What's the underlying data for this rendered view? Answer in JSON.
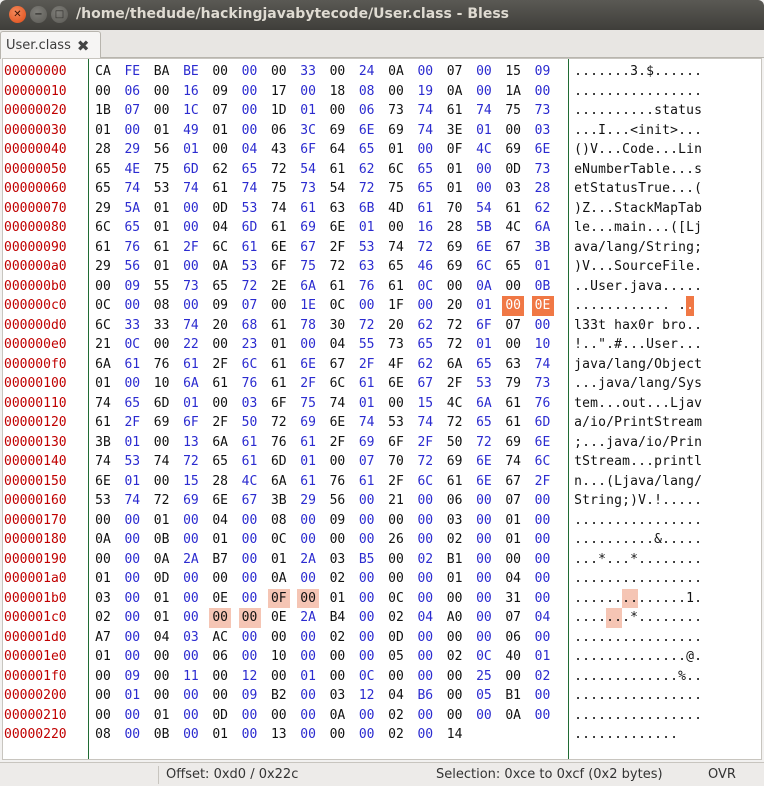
{
  "window": {
    "title": "/home/thedude/hackingjavabytecode/User.class - Bless",
    "close_glyph": "✕",
    "min_glyph": "−",
    "max_glyph": "□"
  },
  "tab": {
    "label": "User.class",
    "close_glyph": "✖"
  },
  "selection": {
    "rows": [
      12
    ],
    "cols": [
      14,
      15
    ],
    "highlight": [
      [
        27,
        6
      ],
      [
        27,
        7
      ],
      [
        28,
        4
      ],
      [
        28,
        5
      ]
    ]
  },
  "colors": {
    "selection": "#f07845",
    "highlight": "#f5c5b4",
    "offset_text": "#c00000",
    "odd_column_text": "#2b2bd0"
  },
  "hex": {
    "rows": [
      {
        "offset": "00000000",
        "bytes": "CA FE BA BE 00 00 00 33 00 24 0A 00 07 00 15 09",
        "ascii": ".......3.$......"
      },
      {
        "offset": "00000010",
        "bytes": "00 06 00 16 09 00 17 00 18 08 00 19 0A 00 1A 00",
        "ascii": "................"
      },
      {
        "offset": "00000020",
        "bytes": "1B 07 00 1C 07 00 1D 01 00 06 73 74 61 74 75 73",
        "ascii": "..........status"
      },
      {
        "offset": "00000030",
        "bytes": "01 00 01 49 01 00 06 3C 69 6E 69 74 3E 01 00 03",
        "ascii": "...I...<init>..."
      },
      {
        "offset": "00000040",
        "bytes": "28 29 56 01 00 04 43 6F 64 65 01 00 0F 4C 69 6E",
        "ascii": "()V...Code...Lin"
      },
      {
        "offset": "00000050",
        "bytes": "65 4E 75 6D 62 65 72 54 61 62 6C 65 01 00 0D 73",
        "ascii": "eNumberTable...s"
      },
      {
        "offset": "00000060",
        "bytes": "65 74 53 74 61 74 75 73 54 72 75 65 01 00 03 28",
        "ascii": "etStatusTrue...("
      },
      {
        "offset": "00000070",
        "bytes": "29 5A 01 00 0D 53 74 61 63 6B 4D 61 70 54 61 62",
        "ascii": ")Z...StackMapTab"
      },
      {
        "offset": "00000080",
        "bytes": "6C 65 01 00 04 6D 61 69 6E 01 00 16 28 5B 4C 6A",
        "ascii": "le...main...([Lj"
      },
      {
        "offset": "00000090",
        "bytes": "61 76 61 2F 6C 61 6E 67 2F 53 74 72 69 6E 67 3B",
        "ascii": "ava/lang/String;"
      },
      {
        "offset": "000000a0",
        "bytes": "29 56 01 00 0A 53 6F 75 72 63 65 46 69 6C 65 01",
        "ascii": ")V...SourceFile."
      },
      {
        "offset": "000000b0",
        "bytes": "00 09 55 73 65 72 2E 6A 61 76 61 0C 00 0A 00 0B",
        "ascii": "..User.java....."
      },
      {
        "offset": "000000c0",
        "bytes": "0C 00 08 00 09 07 00 1E 0C 00 1F 00 20 01 00 0E",
        "ascii": "............ .."
      },
      {
        "offset": "000000d0",
        "bytes": "6C 33 33 74 20 68 61 78 30 72 20 62 72 6F 07 00",
        "ascii": "l33t hax0r bro.."
      },
      {
        "offset": "000000e0",
        "bytes": "21 0C 00 22 00 23 01 00 04 55 73 65 72 01 00 10",
        "ascii": "!..\".#...User..."
      },
      {
        "offset": "000000f0",
        "bytes": "6A 61 76 61 2F 6C 61 6E 67 2F 4F 62 6A 65 63 74",
        "ascii": "java/lang/Object"
      },
      {
        "offset": "00000100",
        "bytes": "01 00 10 6A 61 76 61 2F 6C 61 6E 67 2F 53 79 73",
        "ascii": "...java/lang/Sys"
      },
      {
        "offset": "00000110",
        "bytes": "74 65 6D 01 00 03 6F 75 74 01 00 15 4C 6A 61 76",
        "ascii": "tem...out...Ljav"
      },
      {
        "offset": "00000120",
        "bytes": "61 2F 69 6F 2F 50 72 69 6E 74 53 74 72 65 61 6D",
        "ascii": "a/io/PrintStream"
      },
      {
        "offset": "00000130",
        "bytes": "3B 01 00 13 6A 61 76 61 2F 69 6F 2F 50 72 69 6E",
        "ascii": ";...java/io/Prin"
      },
      {
        "offset": "00000140",
        "bytes": "74 53 74 72 65 61 6D 01 00 07 70 72 69 6E 74 6C",
        "ascii": "tStream...printl"
      },
      {
        "offset": "00000150",
        "bytes": "6E 01 00 15 28 4C 6A 61 76 61 2F 6C 61 6E 67 2F",
        "ascii": "n...(Ljava/lang/"
      },
      {
        "offset": "00000160",
        "bytes": "53 74 72 69 6E 67 3B 29 56 00 21 00 06 00 07 00",
        "ascii": "String;)V.!....."
      },
      {
        "offset": "00000170",
        "bytes": "00 00 01 00 04 00 08 00 09 00 00 00 03 00 01 00",
        "ascii": "................"
      },
      {
        "offset": "00000180",
        "bytes": "0A 00 0B 00 01 00 0C 00 00 00 26 00 02 00 01 00",
        "ascii": "..........&....."
      },
      {
        "offset": "00000190",
        "bytes": "00 00 0A 2A B7 00 01 2A 03 B5 00 02 B1 00 00 00",
        "ascii": "...*...*........"
      },
      {
        "offset": "000001a0",
        "bytes": "01 00 0D 00 00 00 0A 00 02 00 00 00 01 00 04 00",
        "ascii": "................"
      },
      {
        "offset": "000001b0",
        "bytes": "03 00 01 00 0E 00 0F 00 01 00 0C 00 00 00 31 00",
        "ascii": "..............1."
      },
      {
        "offset": "000001c0",
        "bytes": "02 00 01 00 00 00 0E 2A B4 00 02 04 A0 00 07 04",
        "ascii": ".......*........"
      },
      {
        "offset": "000001d0",
        "bytes": "A7 00 04 03 AC 00 00 00 02 00 0D 00 00 00 06 00",
        "ascii": "................"
      },
      {
        "offset": "000001e0",
        "bytes": "01 00 00 00 06 00 10 00 00 00 05 00 02 0C 40 01",
        "ascii": "..............@."
      },
      {
        "offset": "000001f0",
        "bytes": "00 09 00 11 00 12 00 01 00 0C 00 00 00 25 00 02",
        "ascii": ".............%.."
      },
      {
        "offset": "00000200",
        "bytes": "00 01 00 00 00 09 B2 00 03 12 04 B6 00 05 B1 00",
        "ascii": "................"
      },
      {
        "offset": "00000210",
        "bytes": "00 00 01 00 0D 00 00 00 0A 00 02 00 00 00 0A 00",
        "ascii": "................"
      },
      {
        "offset": "00000220",
        "bytes": "08 00 0B 00 01 00 13 00 00 00 02 00 14",
        "ascii": "............."
      }
    ]
  },
  "status": {
    "offset": "Offset: 0xd0 / 0x22c",
    "selection": "Selection: 0xce to 0xcf (0x2 bytes)",
    "mode": "OVR"
  }
}
